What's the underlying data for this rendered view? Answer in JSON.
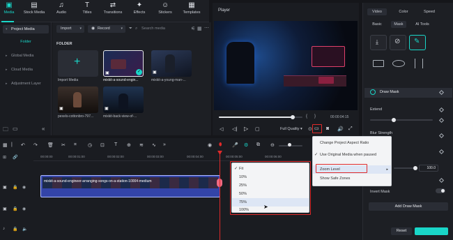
{
  "toolbar": {
    "items": [
      {
        "label": "Media",
        "icon": "media-icon"
      },
      {
        "label": "Stock Media",
        "icon": "stock-media-icon"
      },
      {
        "label": "Audio",
        "icon": "audio-icon"
      },
      {
        "label": "Titles",
        "icon": "titles-icon"
      },
      {
        "label": "Transitions",
        "icon": "transitions-icon"
      },
      {
        "label": "Effects",
        "icon": "effects-icon"
      },
      {
        "label": "Stickers",
        "icon": "stickers-icon"
      },
      {
        "label": "Templates",
        "icon": "templates-icon"
      }
    ],
    "accent": "#19d6c8"
  },
  "sidebar": {
    "items": [
      {
        "label": "Project Media"
      },
      {
        "label": "Folder"
      },
      {
        "label": "Global Media"
      },
      {
        "label": "Cloud Media"
      },
      {
        "label": "Adjustment Layer"
      }
    ]
  },
  "media": {
    "import_label": "Import",
    "record_label": "Record",
    "search_placeholder": "Search media",
    "folder_title": "FOLDER",
    "items": [
      {
        "label": "Import Media"
      },
      {
        "label": "mixkit-a-sound-engin..."
      },
      {
        "label": "mixkit-a-young-man-..."
      },
      {
        "label": "pexels-cottonbro-797..."
      },
      {
        "label": "mixkit-back-view-of-..."
      }
    ]
  },
  "player": {
    "title": "Player",
    "timecode": "00:00:04:15",
    "quality": "Full Quality",
    "progress": 0.88
  },
  "right_panel": {
    "tabs": [
      "Video",
      "Color",
      "Speed"
    ],
    "subtabs": [
      "Basic",
      "Mask",
      "AI Tools"
    ],
    "draw_mask": "Draw Mask",
    "extend": "Extend",
    "blur_strength": "Blur Strength",
    "opacity_value": "100.0",
    "invert_mask": "Invert Mask",
    "add_draw_mask": "Add Draw Mask",
    "reset": "Reset"
  },
  "timeline": {
    "ruler": [
      "00:00:00",
      "00:00:01:00",
      "00:00:02:00",
      "00:00:03:00",
      "00:00:04:00",
      "00:00:05:00",
      "00:00:06:00"
    ],
    "clip_label": "mixkit-a-sound-engineer-arranging-songs-on-a-station-10004-medium"
  },
  "context_menu": {
    "items": [
      "Change Project Aspect Ratio",
      "Use Original Media when paused",
      "Zoom Level",
      "Show Safe Zones"
    ]
  },
  "zoom_menu": {
    "items": [
      "Fit",
      "10%",
      "25%",
      "50%",
      "75%",
      "100%"
    ]
  }
}
